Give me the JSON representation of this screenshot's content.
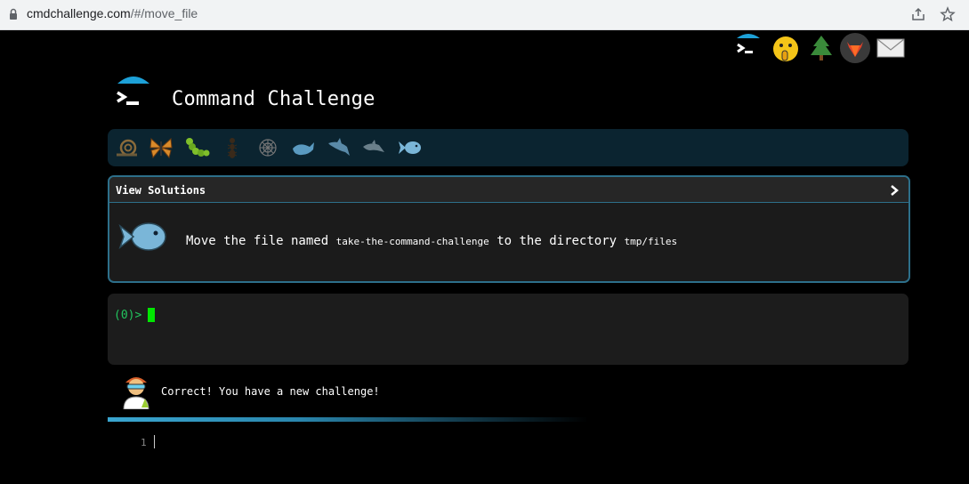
{
  "browser": {
    "url_host": "cmdchallenge.com",
    "url_path": "/#/move_file"
  },
  "top_icons": [
    "terminal-logo-icon",
    "shush-face-icon",
    "tree-icon",
    "gitlab-icon",
    "envelope-icon"
  ],
  "header": {
    "title": "Command Challenge"
  },
  "levels": [
    "snail-icon",
    "butterfly-icon",
    "caterpillar-icon",
    "ant-icon",
    "web-icon",
    "whale-icon",
    "shark-icon",
    "dolphin-icon",
    "fish-icon"
  ],
  "panel": {
    "view_solutions": "View Solutions",
    "task_prefix": "Move the file named",
    "task_file": "take-the-command-challenge",
    "task_middle": "to the directory",
    "task_dir": "tmp/files"
  },
  "terminal": {
    "prompt": "(0)>"
  },
  "status": {
    "message": "Correct! You have a new challenge!"
  },
  "editor": {
    "line_number": "1"
  },
  "colors": {
    "accent": "#2d6f8a",
    "prompt": "#22c55e",
    "cursor": "#00e600",
    "fish": "#7ab6d8"
  }
}
